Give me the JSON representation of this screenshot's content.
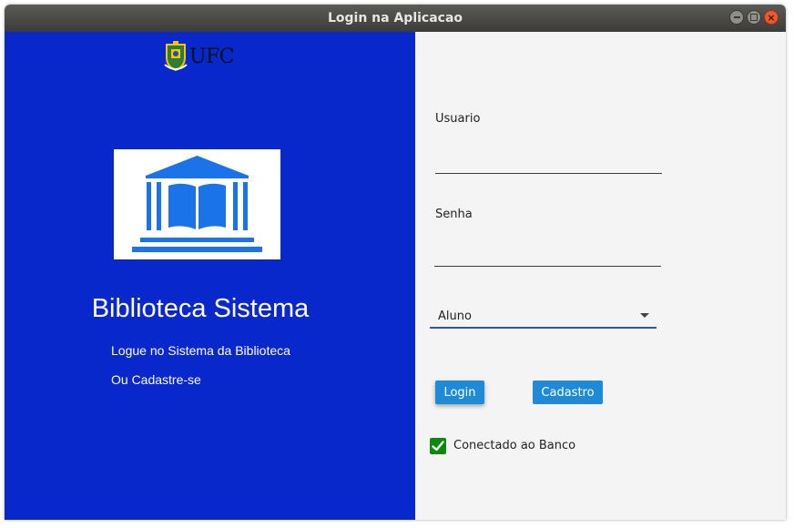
{
  "window": {
    "title": "Login na Aplicacao"
  },
  "branding": {
    "ufc_text": "UFC",
    "app_title": "Biblioteca Sistema",
    "subtitle_login": "Logue no Sistema da Biblioteca",
    "subtitle_register": "Ou Cadastre-se"
  },
  "form": {
    "usuario_label": "Usuario",
    "usuario_value": "",
    "senha_label": "Senha",
    "senha_value": "",
    "user_type_selected": "Aluno",
    "login_button": "Login",
    "register_button": "Cadastro",
    "db_checkbox_label": "Conectado ao Banco",
    "db_checkbox_checked": true
  },
  "colors": {
    "left_panel": "#0928cc",
    "logo_blue": "#1a73e8",
    "button_blue": "#1f8bd6",
    "checkbox_green": "#0c8a0c",
    "right_panel": "#f4f4f4"
  },
  "icons": {
    "crest": "ufc-crest-icon",
    "library": "library-building-icon",
    "check": "checkmark-icon",
    "dropdown": "chevron-down-icon"
  }
}
